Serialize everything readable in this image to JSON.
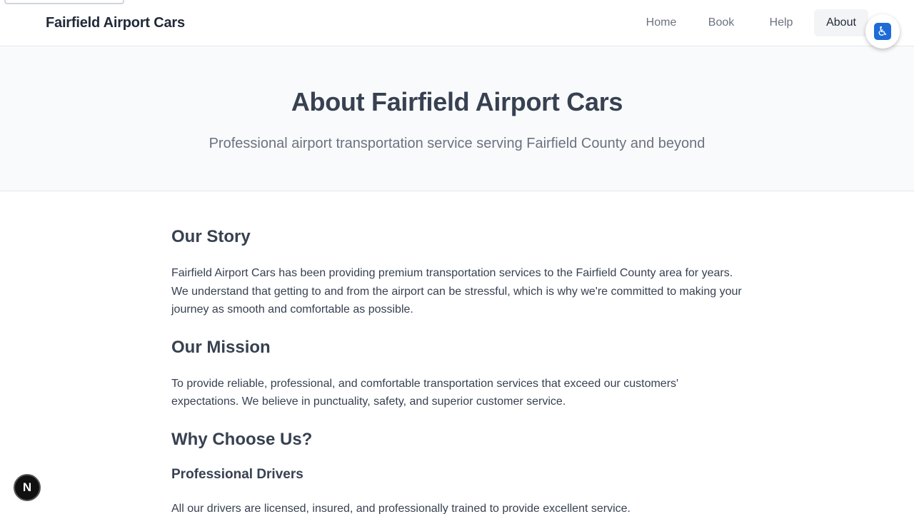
{
  "header": {
    "brand": "Fairfield Airport Cars",
    "nav": [
      {
        "label": "Home",
        "active": false
      },
      {
        "label": "Book",
        "active": false
      },
      {
        "label": "Help",
        "active": false
      },
      {
        "label": "About",
        "active": true
      }
    ]
  },
  "accessibility": {
    "icon": "wheelchair-icon",
    "glyph": "♿",
    "color": "#1d6bd6"
  },
  "hero": {
    "title": "About Fairfield Airport Cars",
    "subtitle": "Professional airport transportation service serving Fairfield County and beyond"
  },
  "sections": {
    "story": {
      "heading": "Our Story",
      "body": "Fairfield Airport Cars has been providing premium transportation services to the Fairfield County area for years. We understand that getting to and from the airport can be stressful, which is why we're committed to making your journey as smooth and comfortable as possible."
    },
    "mission": {
      "heading": "Our Mission",
      "body": "To provide reliable, professional, and comfortable transportation services that exceed our customers' expectations. We believe in punctuality, safety, and superior customer service."
    },
    "why": {
      "heading": "Why Choose Us?",
      "drivers_heading": "Professional Drivers",
      "drivers_body": "All our drivers are licensed, insured, and professionally trained to provide excellent service."
    }
  },
  "dev_badge": {
    "glyph": "N",
    "icon": "nextjs-icon"
  }
}
